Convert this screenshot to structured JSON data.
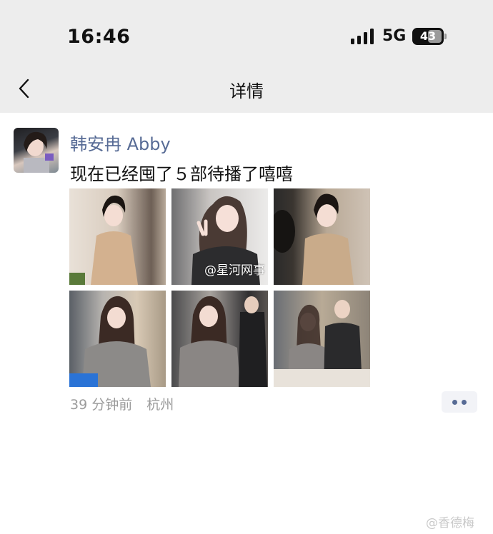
{
  "status_bar": {
    "time": "16:46",
    "network": "5G",
    "battery": "43"
  },
  "nav": {
    "title": "详情"
  },
  "post": {
    "author": "韩安冉 Abby",
    "text": "现在已经囤了５部待播了嘻嘻",
    "meta": {
      "time_ago": "39 分钟前",
      "location": "杭州"
    }
  },
  "watermarks": {
    "center": "@星河网事",
    "corner": "@香德梅"
  }
}
